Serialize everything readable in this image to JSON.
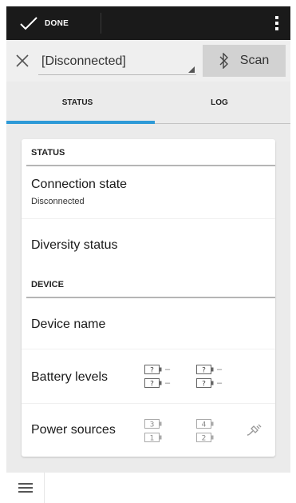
{
  "actionbar": {
    "done_label": "DONE",
    "done_icon": "checkmark-icon",
    "overflow_icon": "overflow-menu-icon"
  },
  "device_bar": {
    "close_icon": "close-icon",
    "device_value": "[Disconnected]",
    "scan_label": "Scan",
    "scan_icon": "bluetooth-icon"
  },
  "tabs": [
    {
      "label": "STATUS",
      "selected": true
    },
    {
      "label": "LOG",
      "selected": false
    }
  ],
  "status_section": {
    "header": "STATUS",
    "connection_state_title": "Connection state",
    "connection_state_value": "Disconnected",
    "diversity_status_title": "Diversity status"
  },
  "device_section": {
    "header": "DEVICE",
    "device_name_title": "Device name",
    "battery_levels_title": "Battery levels",
    "battery_levels": [
      {
        "label": "?",
        "value": "–"
      },
      {
        "label": "?",
        "value": "–"
      },
      {
        "label": "?",
        "value": "–"
      },
      {
        "label": "?",
        "value": "–"
      }
    ],
    "power_sources_title": "Power sources",
    "power_sources": [
      "3",
      "1",
      "4",
      "2"
    ],
    "power_plug_icon": "power-plug-icon"
  },
  "bottom_nav": {
    "menu_icon": "hamburger-menu-icon"
  },
  "colors": {
    "accent": "#2e9ad7",
    "actionbar_bg": "#1a1a1a",
    "toolbar_bg": "#efefef",
    "tabs_bg": "#ebebeb",
    "scan_button_bg": "#d2d2d2",
    "card_bg": "#ffffff"
  }
}
